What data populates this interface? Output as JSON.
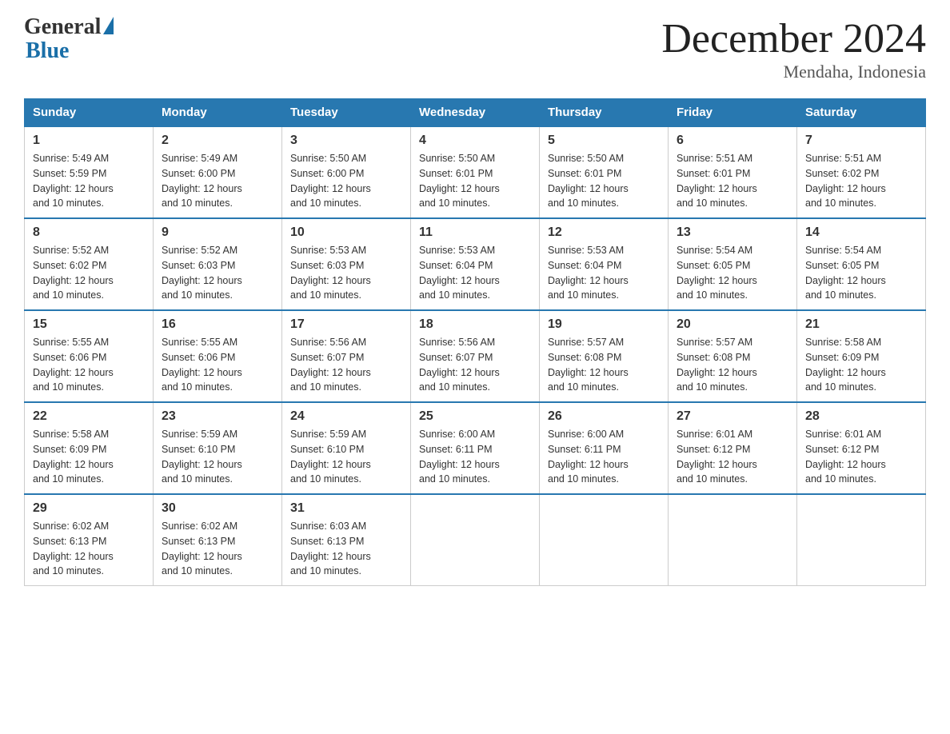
{
  "logo": {
    "text_general": "General",
    "text_blue": "Blue"
  },
  "title": {
    "month_year": "December 2024",
    "location": "Mendaha, Indonesia"
  },
  "headers": [
    "Sunday",
    "Monday",
    "Tuesday",
    "Wednesday",
    "Thursday",
    "Friday",
    "Saturday"
  ],
  "weeks": [
    [
      {
        "day": "1",
        "sunrise": "5:49 AM",
        "sunset": "5:59 PM",
        "daylight": "12 hours and 10 minutes."
      },
      {
        "day": "2",
        "sunrise": "5:49 AM",
        "sunset": "6:00 PM",
        "daylight": "12 hours and 10 minutes."
      },
      {
        "day": "3",
        "sunrise": "5:50 AM",
        "sunset": "6:00 PM",
        "daylight": "12 hours and 10 minutes."
      },
      {
        "day": "4",
        "sunrise": "5:50 AM",
        "sunset": "6:01 PM",
        "daylight": "12 hours and 10 minutes."
      },
      {
        "day": "5",
        "sunrise": "5:50 AM",
        "sunset": "6:01 PM",
        "daylight": "12 hours and 10 minutes."
      },
      {
        "day": "6",
        "sunrise": "5:51 AM",
        "sunset": "6:01 PM",
        "daylight": "12 hours and 10 minutes."
      },
      {
        "day": "7",
        "sunrise": "5:51 AM",
        "sunset": "6:02 PM",
        "daylight": "12 hours and 10 minutes."
      }
    ],
    [
      {
        "day": "8",
        "sunrise": "5:52 AM",
        "sunset": "6:02 PM",
        "daylight": "12 hours and 10 minutes."
      },
      {
        "day": "9",
        "sunrise": "5:52 AM",
        "sunset": "6:03 PM",
        "daylight": "12 hours and 10 minutes."
      },
      {
        "day": "10",
        "sunrise": "5:53 AM",
        "sunset": "6:03 PM",
        "daylight": "12 hours and 10 minutes."
      },
      {
        "day": "11",
        "sunrise": "5:53 AM",
        "sunset": "6:04 PM",
        "daylight": "12 hours and 10 minutes."
      },
      {
        "day": "12",
        "sunrise": "5:53 AM",
        "sunset": "6:04 PM",
        "daylight": "12 hours and 10 minutes."
      },
      {
        "day": "13",
        "sunrise": "5:54 AM",
        "sunset": "6:05 PM",
        "daylight": "12 hours and 10 minutes."
      },
      {
        "day": "14",
        "sunrise": "5:54 AM",
        "sunset": "6:05 PM",
        "daylight": "12 hours and 10 minutes."
      }
    ],
    [
      {
        "day": "15",
        "sunrise": "5:55 AM",
        "sunset": "6:06 PM",
        "daylight": "12 hours and 10 minutes."
      },
      {
        "day": "16",
        "sunrise": "5:55 AM",
        "sunset": "6:06 PM",
        "daylight": "12 hours and 10 minutes."
      },
      {
        "day": "17",
        "sunrise": "5:56 AM",
        "sunset": "6:07 PM",
        "daylight": "12 hours and 10 minutes."
      },
      {
        "day": "18",
        "sunrise": "5:56 AM",
        "sunset": "6:07 PM",
        "daylight": "12 hours and 10 minutes."
      },
      {
        "day": "19",
        "sunrise": "5:57 AM",
        "sunset": "6:08 PM",
        "daylight": "12 hours and 10 minutes."
      },
      {
        "day": "20",
        "sunrise": "5:57 AM",
        "sunset": "6:08 PM",
        "daylight": "12 hours and 10 minutes."
      },
      {
        "day": "21",
        "sunrise": "5:58 AM",
        "sunset": "6:09 PM",
        "daylight": "12 hours and 10 minutes."
      }
    ],
    [
      {
        "day": "22",
        "sunrise": "5:58 AM",
        "sunset": "6:09 PM",
        "daylight": "12 hours and 10 minutes."
      },
      {
        "day": "23",
        "sunrise": "5:59 AM",
        "sunset": "6:10 PM",
        "daylight": "12 hours and 10 minutes."
      },
      {
        "day": "24",
        "sunrise": "5:59 AM",
        "sunset": "6:10 PM",
        "daylight": "12 hours and 10 minutes."
      },
      {
        "day": "25",
        "sunrise": "6:00 AM",
        "sunset": "6:11 PM",
        "daylight": "12 hours and 10 minutes."
      },
      {
        "day": "26",
        "sunrise": "6:00 AM",
        "sunset": "6:11 PM",
        "daylight": "12 hours and 10 minutes."
      },
      {
        "day": "27",
        "sunrise": "6:01 AM",
        "sunset": "6:12 PM",
        "daylight": "12 hours and 10 minutes."
      },
      {
        "day": "28",
        "sunrise": "6:01 AM",
        "sunset": "6:12 PM",
        "daylight": "12 hours and 10 minutes."
      }
    ],
    [
      {
        "day": "29",
        "sunrise": "6:02 AM",
        "sunset": "6:13 PM",
        "daylight": "12 hours and 10 minutes."
      },
      {
        "day": "30",
        "sunrise": "6:02 AM",
        "sunset": "6:13 PM",
        "daylight": "12 hours and 10 minutes."
      },
      {
        "day": "31",
        "sunrise": "6:03 AM",
        "sunset": "6:13 PM",
        "daylight": "12 hours and 10 minutes."
      },
      null,
      null,
      null,
      null
    ]
  ],
  "labels": {
    "sunrise": "Sunrise:",
    "sunset": "Sunset:",
    "daylight": "Daylight:"
  }
}
